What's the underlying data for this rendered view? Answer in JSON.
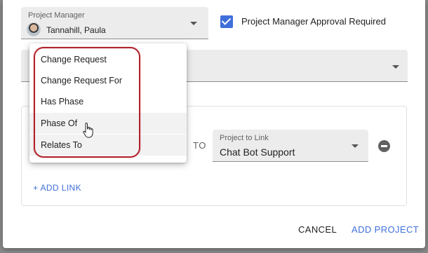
{
  "project_manager": {
    "label": "Project Manager",
    "value": "Tannahill, Paula"
  },
  "approval_checkbox": {
    "label": "Project Manager Approval Required",
    "checked": true
  },
  "link": {
    "to_label": "TO",
    "project_to_link_label": "Project to Link",
    "project_to_link_value": "Chat Bot Support",
    "add_link_label": "+ ADD LINK"
  },
  "dropdown": {
    "items": [
      "Change Request",
      "Change Request For",
      "Has Phase",
      "Phase Of",
      "Relates To"
    ],
    "hovered_item": "Phase Of"
  },
  "footer": {
    "cancel_label": "CANCEL",
    "add_project_label": "ADD PROJECT"
  },
  "colors": {
    "accent": "#3f6fd9",
    "annotation_ring": "#b0202a"
  },
  "icons": {
    "caret": "chevron-down-icon",
    "checkbox": "checkbox-checked-icon",
    "remove": "remove-circle-icon",
    "cursor": "hand-pointer-icon"
  }
}
